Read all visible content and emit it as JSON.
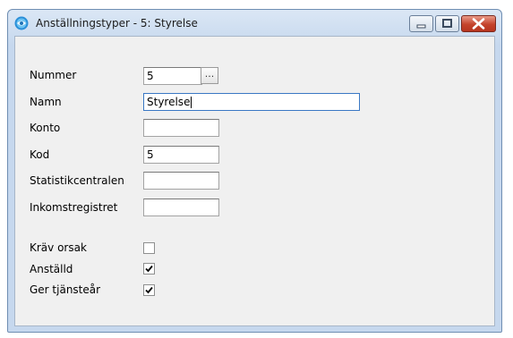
{
  "window": {
    "title": "Anställningstyper - 5: Styrelse",
    "controls": {
      "minimize": "minimize",
      "maximize": "maximize",
      "close": "close"
    }
  },
  "form": {
    "nummer": {
      "label": "Nummer",
      "value": "5",
      "lookup_label": "..."
    },
    "namn": {
      "label": "Namn",
      "value": "Styrelse"
    },
    "konto": {
      "label": "Konto",
      "value": ""
    },
    "kod": {
      "label": "Kod",
      "value": "5"
    },
    "statistikcentralen": {
      "label": "Statistikcentralen",
      "value": ""
    },
    "inkomstregistret": {
      "label": "Inkomstregistret",
      "value": ""
    },
    "krav_orsak": {
      "label": "Kräv orsak",
      "checked": false
    },
    "anstalld": {
      "label": "Anställd",
      "checked": true
    },
    "ger_tjanstear": {
      "label": "Ger tjänsteår",
      "checked": true
    }
  },
  "icons": {
    "app": "app-globe-icon",
    "check": "checkmark-icon"
  }
}
